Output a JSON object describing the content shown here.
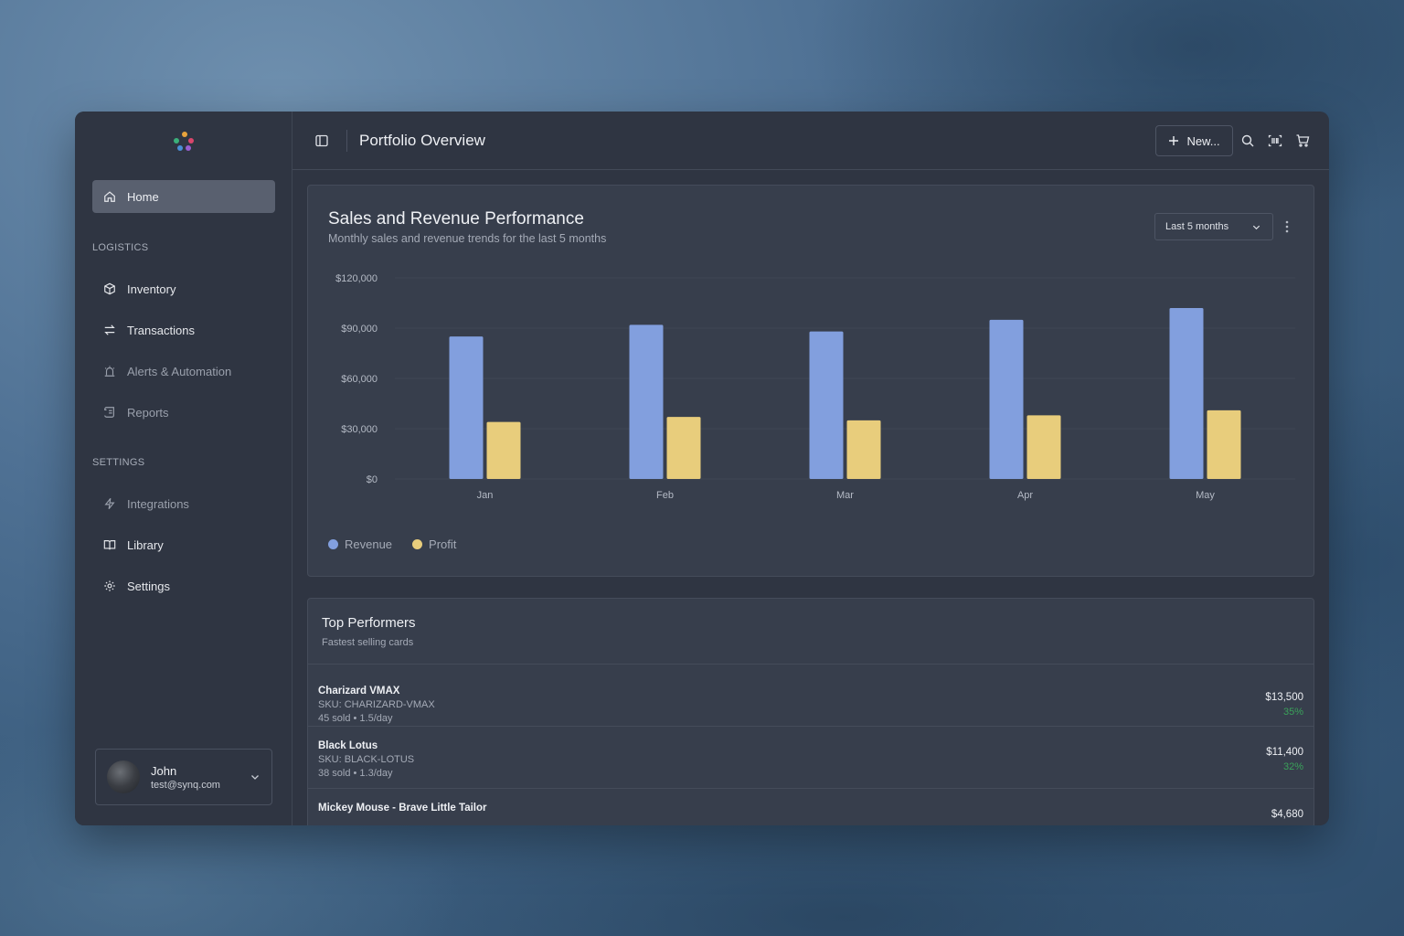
{
  "app": {
    "page_title": "Portfolio Overview",
    "new_button_label": "New..."
  },
  "sidebar": {
    "home_label": "Home",
    "section_logistics": "LOGISTICS",
    "logistics_items": [
      {
        "label": "Inventory",
        "icon": "package-icon"
      },
      {
        "label": "Transactions",
        "icon": "swap-arrows-icon"
      },
      {
        "label": "Alerts & Automation",
        "icon": "alarm-icon"
      },
      {
        "label": "Reports",
        "icon": "scroll-icon"
      }
    ],
    "section_settings": "SETTINGS",
    "settings_items": [
      {
        "label": "Integrations",
        "icon": "lightning-icon"
      },
      {
        "label": "Library",
        "icon": "book-icon"
      },
      {
        "label": "Settings",
        "icon": "gear-icon"
      }
    ],
    "user": {
      "name": "John",
      "email": "test@synq.com"
    }
  },
  "chart_card": {
    "title": "Sales and Revenue Performance",
    "subtitle": "Monthly sales and revenue trends for the last 5 months",
    "range_selected": "Last 5 months"
  },
  "chart_data": {
    "type": "bar",
    "categories": [
      "Jan",
      "Feb",
      "Mar",
      "Apr",
      "May"
    ],
    "series": [
      {
        "name": "Revenue",
        "values": [
          85000,
          92000,
          88000,
          95000,
          102000
        ],
        "color": "#829fde"
      },
      {
        "name": "Profit",
        "values": [
          34000,
          37000,
          35000,
          38000,
          41000
        ],
        "color": "#e8cd7c"
      }
    ],
    "ylim": [
      0,
      120000
    ],
    "yticks": [
      "$0",
      "$30,000",
      "$60,000",
      "$90,000",
      "$120,000"
    ],
    "ytick_values": [
      0,
      30000,
      60000,
      90000,
      120000
    ],
    "legend": "bottom-left",
    "grid": true
  },
  "top_performers": {
    "title": "Top Performers",
    "subtitle": "Fastest selling cards",
    "rows": [
      {
        "name": "Charizard VMAX",
        "sku": "SKU: CHARIZARD-VMAX",
        "meta": "45 sold • 1.5/day",
        "amount": "$13,500",
        "pct": "35%"
      },
      {
        "name": "Black Lotus",
        "sku": "SKU: BLACK-LOTUS",
        "meta": "38 sold • 1.3/day",
        "amount": "$11,400",
        "pct": "32%"
      },
      {
        "name": "Mickey Mouse - Brave Little Tailor",
        "sku": "",
        "meta": "",
        "amount": "$4,680",
        "pct": ""
      }
    ]
  },
  "colors": {
    "success": "#3aa15a",
    "revenue": "#829fde",
    "profit": "#e8cd7c"
  }
}
